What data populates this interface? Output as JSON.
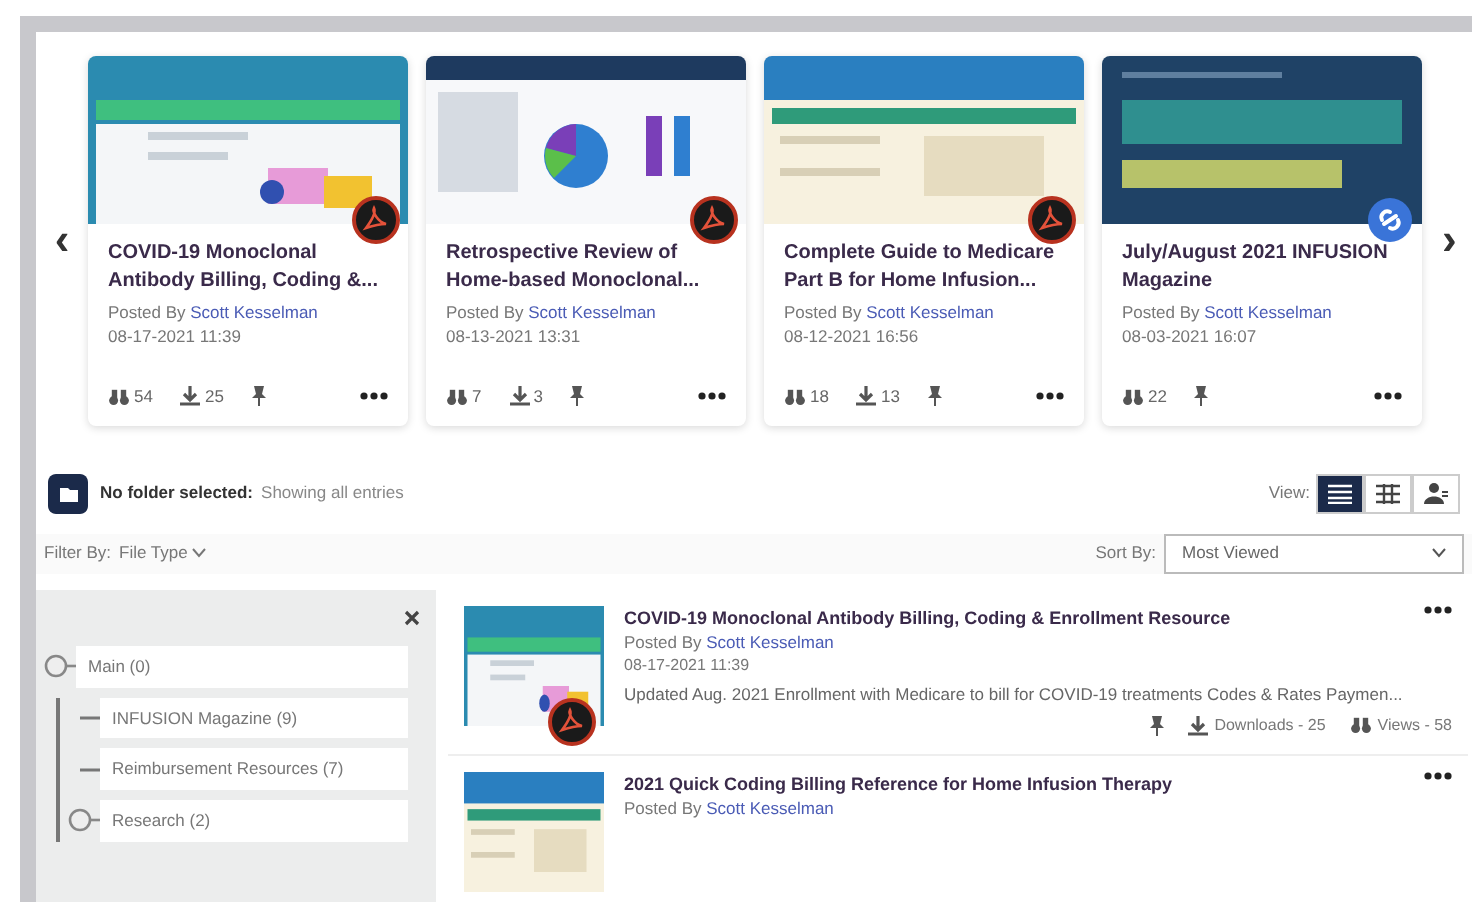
{
  "carousel": {
    "prev": "‹",
    "next": "›",
    "cards": [
      {
        "title": "COVID-19 Monoclonal Antibody Billing, Coding &...",
        "posted_by": "Posted By",
        "author": "Scott Kesselman",
        "date": "08-17-2021 11:39",
        "kind": "pdf",
        "views": "54",
        "downloads": "25"
      },
      {
        "title": "Retrospective Review of Home-based Monoclonal...",
        "posted_by": "Posted By",
        "author": "Scott Kesselman",
        "date": "08-13-2021 13:31",
        "kind": "pdf",
        "views": "7",
        "downloads": "3"
      },
      {
        "title": "Complete Guide to Medicare Part B for Home Infusion...",
        "posted_by": "Posted By",
        "author": "Scott Kesselman",
        "date": "08-12-2021 16:56",
        "kind": "pdf",
        "views": "18",
        "downloads": "13"
      },
      {
        "title": "July/August 2021 INFUSION Magazine",
        "posted_by": "Posted By",
        "author": "Scott Kesselman",
        "date": "08-03-2021 16:07",
        "kind": "link",
        "views": "22"
      }
    ]
  },
  "folder_bar": {
    "label": "No folder selected:",
    "status": "Showing all entries",
    "view_label": "View:",
    "views": [
      {
        "kind": "list",
        "selected": true
      },
      {
        "kind": "grid",
        "selected": false
      },
      {
        "kind": "people",
        "selected": false
      }
    ]
  },
  "filter": {
    "label": "Filter By:",
    "value": "File Type"
  },
  "sort": {
    "label": "Sort By:",
    "value": "Most Viewed"
  },
  "folders": [
    {
      "label": "Main (0)",
      "children": [
        {
          "label": "INFUSION Magazine (9)"
        },
        {
          "label": "Reimbursement Resources (7)"
        },
        {
          "label": "Research (2)",
          "expandable": true
        }
      ]
    }
  ],
  "entries": [
    {
      "title": "COVID-19 Monoclonal Antibody Billing, Coding & Enrollment Resource",
      "posted_by": "Posted By",
      "author": "Scott Kesselman",
      "date": "08-17-2021 11:39",
      "description": "Updated Aug. 2021 Enrollment with Medicare to bill for COVID-19 treatments Codes & Rates Paymen...",
      "downloads": "Downloads - 25",
      "views": "Views - 58"
    },
    {
      "title": "2021 Quick Coding Billing Reference for Home Infusion Therapy",
      "posted_by": "Posted By",
      "author": "Scott Kesselman"
    }
  ]
}
